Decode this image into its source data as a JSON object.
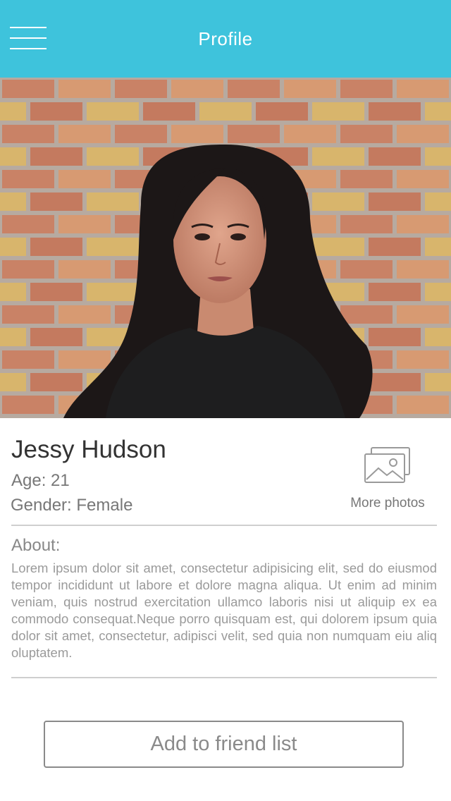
{
  "header": {
    "title": "Profile",
    "menu_icon": "hamburger-menu-icon",
    "background_color": "#3ec3dc"
  },
  "profile": {
    "photo_description_icon": "profile-photo",
    "name": "Jessy Hudson",
    "age": "Age: 21",
    "gender": "Gender: Female",
    "more_photos": {
      "icon": "image-gallery-icon",
      "label": "More photos"
    }
  },
  "about": {
    "heading": "About:",
    "text": "Lorem ipsum dolor sit amet, consectetur adipisicing elit, sed do eiusmod tempor incididunt ut labore et dolore magna aliqua. Ut enim ad minim veniam, quis nostrud exercitation ullamco laboris nisi ut aliquip ex ea commodo consequat.Neque porro quisquam est, qui dolorem ipsum quia dolor sit amet, consectetur, adipisci velit, sed quia non numquam eiu aliq oluptatem."
  },
  "actions": {
    "add_friend_label": "Add to friend list"
  }
}
